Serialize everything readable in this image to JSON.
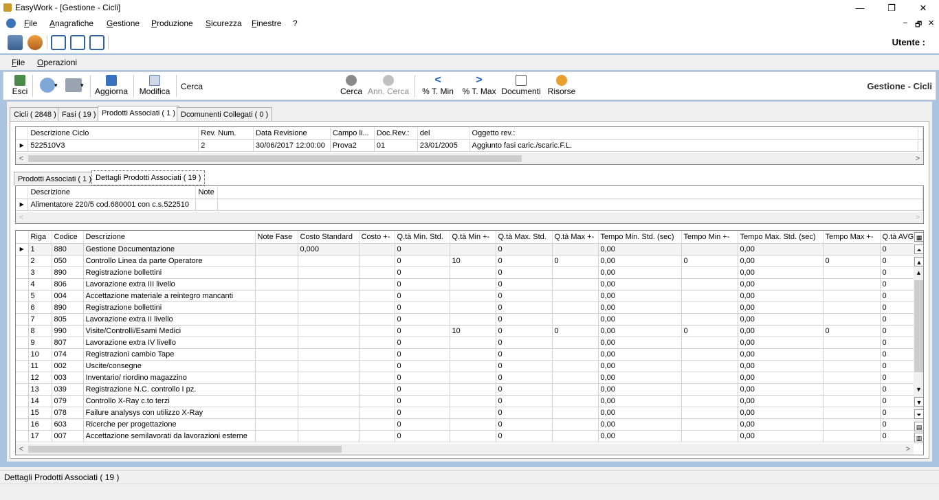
{
  "window": {
    "title": "EasyWork - [Gestione - Cicli]",
    "minimize_glyph": "—",
    "restore_glyph": "❐",
    "close_glyph": "✕"
  },
  "menubar": {
    "items": [
      "File",
      "Anagrafiche",
      "Gestione",
      "Produzione",
      "Sicurezza",
      "Finestre",
      "?"
    ],
    "mdi_glyphs": [
      "–",
      "🗗",
      "✕"
    ]
  },
  "toolbar1": {
    "utente_label": "Utente :"
  },
  "submenu": {
    "items": [
      "File",
      "Operazioni"
    ]
  },
  "toolbar2": {
    "esci": "Esci",
    "aggiorna": "Aggiorna",
    "modifica": "Modifica",
    "cerca_label": "Cerca",
    "cerca_value": "",
    "cerca_button": "Cerca",
    "ann_cerca": "Ann. Cerca",
    "t_min": "% T. Min",
    "t_max": "% T. Max",
    "documenti": "Documenti",
    "risorse": "Risorse",
    "form_title": "Gestione - Cicli"
  },
  "tabs": [
    "Cicli ( 2848 )",
    "Fasi ( 19 )",
    "Prodotti Associati ( 1 )",
    "Dcomunenti Collegati ( 0 )"
  ],
  "cicli_grid": {
    "columns": [
      "Descrizione Ciclo",
      "Rev. Num.",
      "Data Revisione",
      "Campo li...",
      "Doc.Rev.:",
      "del",
      "Oggetto rev.:"
    ],
    "row": [
      "522510V3",
      "2",
      "30/06/2017 12:00:00",
      "Prova2",
      "01",
      "23/01/2005",
      "Aggiunto fasi caric./scaric.F.L."
    ]
  },
  "subtabs": [
    "Prodotti Associati ( 1 )",
    "Dettagli Prodotti Associati ( 19 )"
  ],
  "prodotti_grid": {
    "columns": [
      "Descrizione",
      "Note"
    ],
    "row": [
      "Alimentatore 220/5 cod.680001 con c.s.522510",
      ""
    ]
  },
  "dettagli_grid": {
    "columns": [
      "Riga",
      "Codice",
      "Descrizione",
      "Note Fase",
      "Costo Standard",
      "Costo +-",
      "Q.tà Min. Std.",
      "Q.tà Min +-",
      "Q.tà Max. Std.",
      "Q.tà Max +-",
      "Tempo Min. Std. (sec)",
      "Tempo Min +-",
      "Tempo Max. Std. (sec)",
      "Tempo Max +-",
      "Q.tà AVG"
    ],
    "rows": [
      [
        "1",
        "880",
        "Gestione Documentazione",
        "",
        "0,000",
        "",
        "0",
        "",
        "0",
        "",
        "0,00",
        "",
        "0,00",
        "",
        "0"
      ],
      [
        "2",
        "050",
        "Controllo Linea da parte Operatore",
        "",
        "",
        "",
        "0",
        "10",
        "0",
        "0",
        "0,00",
        "0",
        "0,00",
        "0",
        "0"
      ],
      [
        "3",
        "890",
        "Registrazione bollettini",
        "",
        "",
        "",
        "0",
        "",
        "0",
        "",
        "0,00",
        "",
        "0,00",
        "",
        "0"
      ],
      [
        "4",
        "806",
        "Lavorazione extra III livello",
        "",
        "",
        "",
        "0",
        "",
        "0",
        "",
        "0,00",
        "",
        "0,00",
        "",
        "0"
      ],
      [
        "5",
        "004",
        "Accettazione materiale a reintegro mancanti",
        "",
        "",
        "",
        "0",
        "",
        "0",
        "",
        "0,00",
        "",
        "0,00",
        "",
        "0"
      ],
      [
        "6",
        "890",
        "Registrazione bollettini",
        "",
        "",
        "",
        "0",
        "",
        "0",
        "",
        "0,00",
        "",
        "0,00",
        "",
        "0"
      ],
      [
        "7",
        "805",
        "Lavorazione extra II livello",
        "",
        "",
        "",
        "0",
        "",
        "0",
        "",
        "0,00",
        "",
        "0,00",
        "",
        "0"
      ],
      [
        "8",
        "990",
        "Visite/Controlli/Esami Medici",
        "",
        "",
        "",
        "0",
        "10",
        "0",
        "0",
        "0,00",
        "0",
        "0,00",
        "0",
        "0"
      ],
      [
        "9",
        "807",
        "Lavorazione extra IV livello",
        "",
        "",
        "",
        "0",
        "",
        "0",
        "",
        "0,00",
        "",
        "0,00",
        "",
        "0"
      ],
      [
        "10",
        "074",
        "Registrazioni cambio Tape",
        "",
        "",
        "",
        "0",
        "",
        "0",
        "",
        "0,00",
        "",
        "0,00",
        "",
        "0"
      ],
      [
        "11",
        "002",
        "Uscite/consegne",
        "",
        "",
        "",
        "0",
        "",
        "0",
        "",
        "0,00",
        "",
        "0,00",
        "",
        "0"
      ],
      [
        "12",
        "003",
        "Inventario/ riordino magazzino",
        "",
        "",
        "",
        "0",
        "",
        "0",
        "",
        "0,00",
        "",
        "0,00",
        "",
        "0"
      ],
      [
        "13",
        "039",
        "Registrazione N.C. controllo I pz.",
        "",
        "",
        "",
        "0",
        "",
        "0",
        "",
        "0,00",
        "",
        "0,00",
        "",
        "0"
      ],
      [
        "14",
        "079",
        "Controllo X-Ray c.to terzi",
        "",
        "",
        "",
        "0",
        "",
        "0",
        "",
        "0,00",
        "",
        "0,00",
        "",
        "0"
      ],
      [
        "15",
        "078",
        "Failure analysys con utilizzo X-Ray",
        "",
        "",
        "",
        "0",
        "",
        "0",
        "",
        "0,00",
        "",
        "0,00",
        "",
        "0"
      ],
      [
        "16",
        "603",
        "Ricerche per progettazione",
        "",
        "",
        "",
        "0",
        "",
        "0",
        "",
        "0,00",
        "",
        "0,00",
        "",
        "0"
      ],
      [
        "17",
        "007",
        "Accettazione semilavorati da lavorazioni esterne",
        "",
        "",
        "",
        "0",
        "",
        "0",
        "",
        "0,00",
        "",
        "0,00",
        "",
        "0"
      ]
    ]
  },
  "statusbar": {
    "text": "Dettagli Prodotti Associati ( 19 )"
  },
  "glyphs": {
    "row_pointer": "▶",
    "left_arrow": "<",
    "right_arrow": ">",
    "dropdown": "▾"
  }
}
